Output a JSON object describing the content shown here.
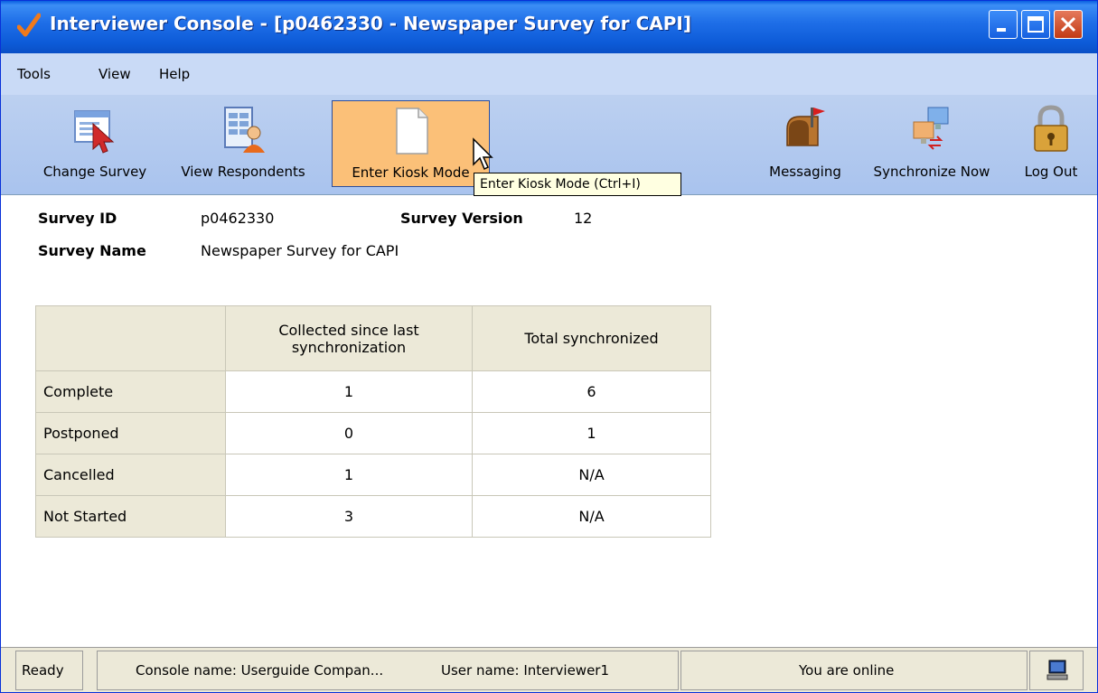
{
  "window": {
    "title": "Interviewer Console - [p0462330 - Newspaper Survey for CAPI]"
  },
  "menu": {
    "items": [
      "Tools",
      "View",
      "Help"
    ]
  },
  "toolbar": {
    "change_survey": "Change Survey",
    "view_respondents": "View Respondents",
    "enter_kiosk_mode": "Enter Kiosk Mode",
    "messaging": "Messaging",
    "synchronize_now": "Synchronize Now",
    "log_out": "Log Out",
    "tooltip": "Enter Kiosk Mode (Ctrl+I)"
  },
  "survey": {
    "id_label": "Survey ID",
    "id_value": "p0462330",
    "version_label": "Survey Version",
    "version_value": "12",
    "name_label": "Survey Name",
    "name_value": "Newspaper Survey for CAPI"
  },
  "stats_table": {
    "headers": [
      "",
      "Collected since last synchronization",
      "Total synchronized"
    ],
    "rows": [
      {
        "label": "Complete",
        "collected": "1",
        "total": "6"
      },
      {
        "label": "Postponed",
        "collected": "0",
        "total": "1"
      },
      {
        "label": "Cancelled",
        "collected": "1",
        "total": "N/A"
      },
      {
        "label": "Not Started",
        "collected": "3",
        "total": "N/A"
      }
    ]
  },
  "statusbar": {
    "state": "Ready",
    "console_name": "Console name:  Userguide Compan...",
    "user_name": "User name: Interviewer1",
    "online": "You are online"
  }
}
